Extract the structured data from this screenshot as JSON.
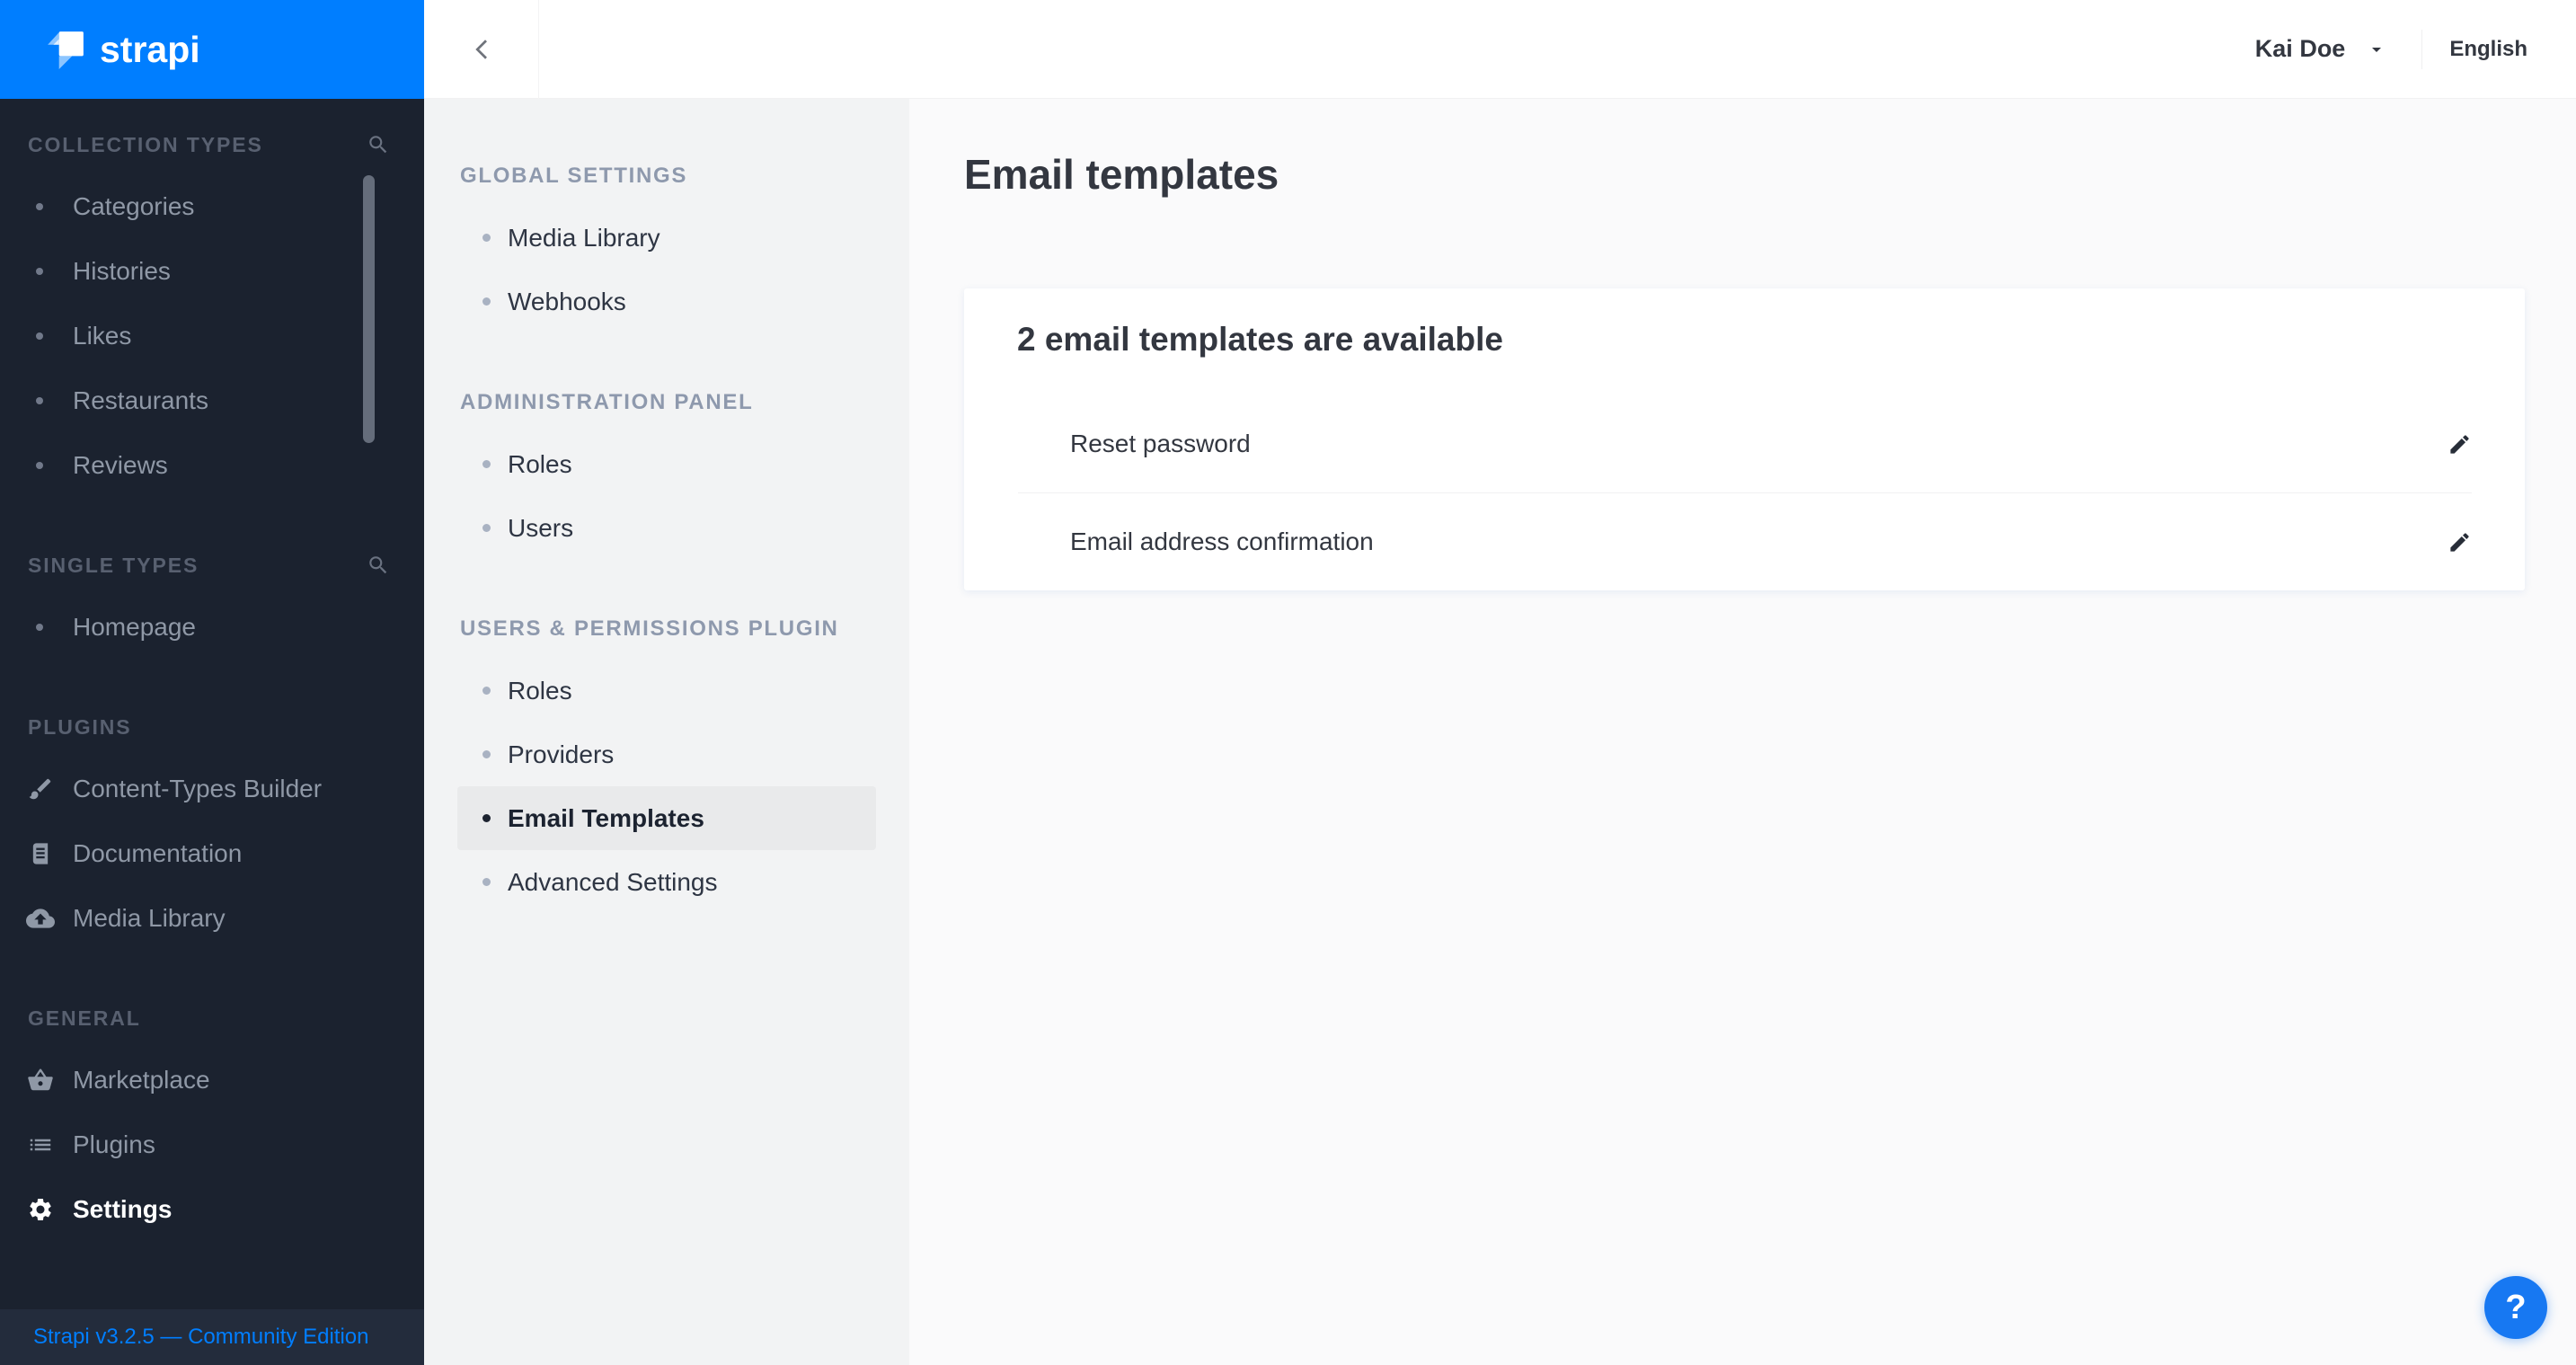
{
  "colors": {
    "brand_blue": "#007eff",
    "help_button_blue": "#1778f2",
    "menu_background": "#1b222f",
    "footer_link_blue": "#007eff"
  },
  "brand": {
    "name": "strapi",
    "logo_icon": "strapi-logo-icon"
  },
  "left_menu": {
    "sections": [
      {
        "label": "COLLECTION TYPES",
        "search_icon": "search-icon",
        "items": [
          {
            "label": "Categories"
          },
          {
            "label": "Histories"
          },
          {
            "label": "Likes"
          },
          {
            "label": "Restaurants"
          },
          {
            "label": "Reviews"
          }
        ]
      },
      {
        "label": "SINGLE TYPES",
        "search_icon": "search-icon",
        "items": [
          {
            "label": "Homepage"
          }
        ]
      },
      {
        "label": "PLUGINS",
        "items": [
          {
            "label": "Content-Types Builder",
            "icon": "brush-icon"
          },
          {
            "label": "Documentation",
            "icon": "book-icon"
          },
          {
            "label": "Media Library",
            "icon": "cloud-upload-icon"
          }
        ]
      },
      {
        "label": "GENERAL",
        "items": [
          {
            "label": "Marketplace",
            "icon": "basket-icon"
          },
          {
            "label": "Plugins",
            "icon": "list-icon"
          },
          {
            "label": "Settings",
            "icon": "gear-icon",
            "active": true
          }
        ]
      }
    ],
    "footer_text": "Strapi v3.2.5 — Community Edition"
  },
  "header": {
    "back_icon": "chevron-left-icon",
    "user_name": "Kai Doe",
    "user_caret_icon": "caret-down-icon",
    "language": "English"
  },
  "settings_nav": {
    "sections": [
      {
        "label": "GLOBAL SETTINGS",
        "items": [
          "Media Library",
          "Webhooks"
        ]
      },
      {
        "label": "ADMINISTRATION PANEL",
        "items": [
          "Roles",
          "Users"
        ]
      },
      {
        "label": "USERS & PERMISSIONS PLUGIN",
        "items": [
          "Roles",
          "Providers",
          "Email Templates",
          "Advanced Settings"
        ],
        "active_item": "Email Templates"
      }
    ]
  },
  "main": {
    "page_title": "Email templates",
    "card": {
      "title": "2 email templates are available",
      "rows": [
        {
          "label": "Reset password",
          "action_icon": "pencil-icon"
        },
        {
          "label": "Email address confirmation",
          "action_icon": "pencil-icon"
        }
      ]
    }
  },
  "help": {
    "label": "?"
  }
}
